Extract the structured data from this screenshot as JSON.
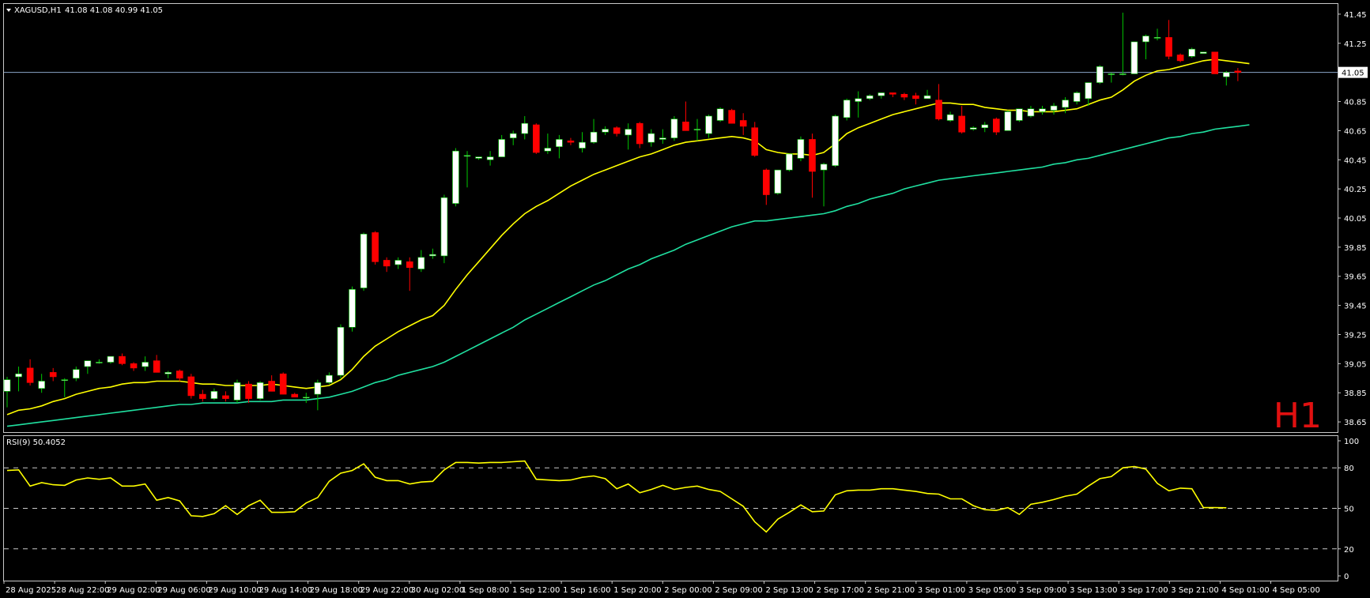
{
  "header": {
    "symbol": "XAGUSD,H1",
    "ohlc": "41.08 41.08 40.99 41.05"
  },
  "timeframe_watermark": "H1",
  "rsi_header": "RSI(9) 50.4052",
  "colors": {
    "background": "#000000",
    "frame": "#c8c8c8",
    "bull_candle": "#ffffff",
    "bear_candle": "#ff0000",
    "wick_bull": "#00c800",
    "wick_bear": "#ff0000",
    "ma_fast": "#ffff00",
    "ma_slow": "#20e0a0",
    "rsi_line": "#ffff00",
    "price_line": "#8aa6c8",
    "watermark": "#e01010"
  },
  "chart_data": [
    {
      "type": "candlestick",
      "instrument": "XAGUSD",
      "timeframe": "H1",
      "ylim": [
        38.58,
        41.52
      ],
      "y_ticks": [
        41.45,
        41.25,
        41.05,
        40.85,
        40.65,
        40.45,
        40.25,
        40.05,
        39.85,
        39.65,
        39.45,
        39.25,
        39.05,
        38.85,
        38.65
      ],
      "last_price": 41.05,
      "x_labels": [
        "28 Aug 2025",
        "28 Aug 22:00",
        "29 Aug 02:00",
        "29 Aug 06:00",
        "29 Aug 10:00",
        "29 Aug 14:00",
        "29 Aug 18:00",
        "29 Aug 22:00",
        "30 Aug 02:00",
        "1 Sep 08:00",
        "1 Sep 12:00",
        "1 Sep 16:00",
        "1 Sep 20:00",
        "2 Sep 00:00",
        "2 Sep 09:00",
        "2 Sep 13:00",
        "2 Sep 17:00",
        "2 Sep 21:00",
        "3 Sep 01:00",
        "3 Sep 05:00",
        "3 Sep 09:00",
        "3 Sep 13:00",
        "3 Sep 17:00",
        "3 Sep 21:00",
        "4 Sep 01:00",
        "4 Sep 05:00"
      ],
      "candles": [
        {
          "o": 38.86,
          "h": 38.96,
          "l": 38.75,
          "c": 38.94
        },
        {
          "o": 38.96,
          "h": 39.03,
          "l": 38.86,
          "c": 38.98
        },
        {
          "o": 39.02,
          "h": 39.08,
          "l": 38.9,
          "c": 38.92
        },
        {
          "o": 38.88,
          "h": 38.98,
          "l": 38.85,
          "c": 38.93
        },
        {
          "o": 38.99,
          "h": 39.02,
          "l": 38.93,
          "c": 38.96
        },
        {
          "o": 38.94,
          "h": 38.95,
          "l": 38.82,
          "c": 38.94
        },
        {
          "o": 38.95,
          "h": 39.03,
          "l": 38.93,
          "c": 39.01
        },
        {
          "o": 39.03,
          "h": 39.07,
          "l": 38.98,
          "c": 39.07
        },
        {
          "o": 39.06,
          "h": 39.08,
          "l": 39.05,
          "c": 39.06
        },
        {
          "o": 39.06,
          "h": 39.1,
          "l": 39.05,
          "c": 39.1
        },
        {
          "o": 39.1,
          "h": 39.12,
          "l": 39.04,
          "c": 39.05
        },
        {
          "o": 39.05,
          "h": 39.06,
          "l": 39.0,
          "c": 39.02
        },
        {
          "o": 39.03,
          "h": 39.1,
          "l": 39.0,
          "c": 39.06
        },
        {
          "o": 39.07,
          "h": 39.11,
          "l": 38.99,
          "c": 38.99
        },
        {
          "o": 38.98,
          "h": 39.0,
          "l": 38.95,
          "c": 38.99
        },
        {
          "o": 39.0,
          "h": 39.01,
          "l": 38.93,
          "c": 38.95
        },
        {
          "o": 38.96,
          "h": 38.98,
          "l": 38.81,
          "c": 38.83
        },
        {
          "o": 38.84,
          "h": 38.87,
          "l": 38.79,
          "c": 38.81
        },
        {
          "o": 38.81,
          "h": 38.88,
          "l": 38.8,
          "c": 38.86
        },
        {
          "o": 38.83,
          "h": 38.86,
          "l": 38.79,
          "c": 38.81
        },
        {
          "o": 38.8,
          "h": 38.94,
          "l": 38.78,
          "c": 38.92
        },
        {
          "o": 38.91,
          "h": 38.93,
          "l": 38.78,
          "c": 38.81
        },
        {
          "o": 38.81,
          "h": 38.93,
          "l": 38.8,
          "c": 38.92
        },
        {
          "o": 38.93,
          "h": 38.97,
          "l": 38.86,
          "c": 38.86
        },
        {
          "o": 38.98,
          "h": 38.99,
          "l": 38.84,
          "c": 38.84
        },
        {
          "o": 38.84,
          "h": 38.85,
          "l": 38.82,
          "c": 38.82
        },
        {
          "o": 38.82,
          "h": 38.85,
          "l": 38.78,
          "c": 38.82
        },
        {
          "o": 38.84,
          "h": 38.94,
          "l": 38.73,
          "c": 38.92
        },
        {
          "o": 38.92,
          "h": 38.99,
          "l": 38.91,
          "c": 38.97
        },
        {
          "o": 38.97,
          "h": 39.32,
          "l": 38.95,
          "c": 39.3
        },
        {
          "o": 39.3,
          "h": 39.58,
          "l": 39.27,
          "c": 39.56
        },
        {
          "o": 39.57,
          "h": 39.95,
          "l": 39.55,
          "c": 39.94
        },
        {
          "o": 39.95,
          "h": 39.96,
          "l": 39.73,
          "c": 39.75
        },
        {
          "o": 39.76,
          "h": 39.78,
          "l": 39.68,
          "c": 39.72
        },
        {
          "o": 39.73,
          "h": 39.78,
          "l": 39.7,
          "c": 39.76
        },
        {
          "o": 39.75,
          "h": 39.78,
          "l": 39.55,
          "c": 39.71
        },
        {
          "o": 39.7,
          "h": 39.83,
          "l": 39.68,
          "c": 39.78
        },
        {
          "o": 39.79,
          "h": 39.84,
          "l": 39.77,
          "c": 39.8
        },
        {
          "o": 39.79,
          "h": 40.21,
          "l": 39.74,
          "c": 40.19
        },
        {
          "o": 40.15,
          "h": 40.53,
          "l": 40.13,
          "c": 40.51
        },
        {
          "o": 40.48,
          "h": 40.51,
          "l": 40.26,
          "c": 40.48
        },
        {
          "o": 40.46,
          "h": 40.47,
          "l": 40.45,
          "c": 40.47
        },
        {
          "o": 40.45,
          "h": 40.51,
          "l": 40.41,
          "c": 40.47
        },
        {
          "o": 40.47,
          "h": 40.62,
          "l": 40.47,
          "c": 40.59
        },
        {
          "o": 40.6,
          "h": 40.65,
          "l": 40.55,
          "c": 40.63
        },
        {
          "o": 40.63,
          "h": 40.75,
          "l": 40.59,
          "c": 40.7
        },
        {
          "o": 40.69,
          "h": 40.7,
          "l": 40.49,
          "c": 40.5
        },
        {
          "o": 40.51,
          "h": 40.63,
          "l": 40.49,
          "c": 40.53
        },
        {
          "o": 40.54,
          "h": 40.62,
          "l": 40.46,
          "c": 40.59
        },
        {
          "o": 40.58,
          "h": 40.6,
          "l": 40.55,
          "c": 40.57
        },
        {
          "o": 40.53,
          "h": 40.64,
          "l": 40.5,
          "c": 40.57
        },
        {
          "o": 40.57,
          "h": 40.73,
          "l": 40.56,
          "c": 40.64
        },
        {
          "o": 40.64,
          "h": 40.68,
          "l": 40.62,
          "c": 40.66
        },
        {
          "o": 40.67,
          "h": 40.68,
          "l": 40.61,
          "c": 40.63
        },
        {
          "o": 40.62,
          "h": 40.7,
          "l": 40.52,
          "c": 40.66
        },
        {
          "o": 40.7,
          "h": 40.71,
          "l": 40.53,
          "c": 40.56
        },
        {
          "o": 40.57,
          "h": 40.66,
          "l": 40.54,
          "c": 40.63
        },
        {
          "o": 40.59,
          "h": 40.66,
          "l": 40.56,
          "c": 40.6
        },
        {
          "o": 40.6,
          "h": 40.75,
          "l": 40.58,
          "c": 40.73
        },
        {
          "o": 40.71,
          "h": 40.85,
          "l": 40.7,
          "c": 40.65
        },
        {
          "o": 40.66,
          "h": 40.73,
          "l": 40.58,
          "c": 40.66
        },
        {
          "o": 40.63,
          "h": 40.76,
          "l": 40.6,
          "c": 40.75
        },
        {
          "o": 40.72,
          "h": 40.81,
          "l": 40.71,
          "c": 40.8
        },
        {
          "o": 40.79,
          "h": 40.8,
          "l": 40.7,
          "c": 40.7
        },
        {
          "o": 40.72,
          "h": 40.77,
          "l": 40.62,
          "c": 40.68
        },
        {
          "o": 40.67,
          "h": 40.71,
          "l": 40.47,
          "c": 40.48
        },
        {
          "o": 40.38,
          "h": 40.39,
          "l": 40.14,
          "c": 40.21
        },
        {
          "o": 40.22,
          "h": 40.26,
          "l": 40.21,
          "c": 40.38
        },
        {
          "o": 40.38,
          "h": 40.49,
          "l": 40.37,
          "c": 40.49
        },
        {
          "o": 40.46,
          "h": 40.61,
          "l": 40.44,
          "c": 40.59
        },
        {
          "o": 40.59,
          "h": 40.63,
          "l": 40.19,
          "c": 40.37
        },
        {
          "o": 40.38,
          "h": 40.43,
          "l": 40.13,
          "c": 40.42
        },
        {
          "o": 40.41,
          "h": 40.76,
          "l": 40.4,
          "c": 40.75
        },
        {
          "o": 40.74,
          "h": 40.87,
          "l": 40.72,
          "c": 40.86
        },
        {
          "o": 40.85,
          "h": 40.92,
          "l": 40.74,
          "c": 40.87
        },
        {
          "o": 40.87,
          "h": 40.9,
          "l": 40.86,
          "c": 40.89
        },
        {
          "o": 40.89,
          "h": 40.91,
          "l": 40.87,
          "c": 40.91
        },
        {
          "o": 40.91,
          "h": 40.91,
          "l": 40.88,
          "c": 40.9
        },
        {
          "o": 40.9,
          "h": 40.91,
          "l": 40.86,
          "c": 40.88
        },
        {
          "o": 40.89,
          "h": 40.91,
          "l": 40.83,
          "c": 40.87
        },
        {
          "o": 40.87,
          "h": 40.93,
          "l": 40.87,
          "c": 40.89
        },
        {
          "o": 40.86,
          "h": 40.97,
          "l": 40.72,
          "c": 40.73
        },
        {
          "o": 40.72,
          "h": 40.78,
          "l": 40.71,
          "c": 40.76
        },
        {
          "o": 40.75,
          "h": 40.82,
          "l": 40.63,
          "c": 40.64
        },
        {
          "o": 40.66,
          "h": 40.68,
          "l": 40.65,
          "c": 40.67
        },
        {
          "o": 40.67,
          "h": 40.71,
          "l": 40.64,
          "c": 40.69
        },
        {
          "o": 40.73,
          "h": 40.74,
          "l": 40.62,
          "c": 40.64
        },
        {
          "o": 40.65,
          "h": 40.79,
          "l": 40.65,
          "c": 40.78
        },
        {
          "o": 40.72,
          "h": 40.79,
          "l": 40.71,
          "c": 40.8
        },
        {
          "o": 40.75,
          "h": 40.82,
          "l": 40.74,
          "c": 40.8
        },
        {
          "o": 40.78,
          "h": 40.82,
          "l": 40.76,
          "c": 40.8
        },
        {
          "o": 40.79,
          "h": 40.84,
          "l": 40.76,
          "c": 40.82
        },
        {
          "o": 40.81,
          "h": 40.88,
          "l": 40.77,
          "c": 40.86
        },
        {
          "o": 40.85,
          "h": 40.92,
          "l": 40.83,
          "c": 40.91
        },
        {
          "o": 40.87,
          "h": 40.98,
          "l": 40.82,
          "c": 40.98
        },
        {
          "o": 40.98,
          "h": 41.1,
          "l": 40.97,
          "c": 41.09
        },
        {
          "o": 41.04,
          "h": 41.05,
          "l": 40.98,
          "c": 41.04
        },
        {
          "o": 41.04,
          "h": 41.46,
          "l": 41.03,
          "c": 41.04
        },
        {
          "o": 41.04,
          "h": 41.25,
          "l": 41.04,
          "c": 41.26
        },
        {
          "o": 41.26,
          "h": 41.31,
          "l": 41.14,
          "c": 41.3
        },
        {
          "o": 41.29,
          "h": 41.35,
          "l": 41.27,
          "c": 41.29
        },
        {
          "o": 41.29,
          "h": 41.41,
          "l": 41.14,
          "c": 41.16
        },
        {
          "o": 41.17,
          "h": 41.18,
          "l": 41.12,
          "c": 41.13
        },
        {
          "o": 41.16,
          "h": 41.22,
          "l": 41.15,
          "c": 41.21
        },
        {
          "o": 41.18,
          "h": 41.19,
          "l": 41.19,
          "c": 41.19
        },
        {
          "o": 41.19,
          "h": 41.19,
          "l": 41.04,
          "c": 41.04
        },
        {
          "o": 41.02,
          "h": 41.06,
          "l": 40.96,
          "c": 41.05
        },
        {
          "o": 41.06,
          "h": 41.08,
          "l": 40.99,
          "c": 41.05
        }
      ],
      "ma_fast": [
        38.7,
        38.73,
        38.74,
        38.76,
        38.79,
        38.81,
        38.84,
        38.86,
        38.88,
        38.89,
        38.91,
        38.92,
        38.92,
        38.93,
        38.93,
        38.93,
        38.92,
        38.91,
        38.91,
        38.9,
        38.9,
        38.9,
        38.9,
        38.91,
        38.9,
        38.89,
        38.88,
        38.89,
        38.9,
        38.94,
        39.01,
        39.1,
        39.17,
        39.22,
        39.27,
        39.31,
        39.35,
        39.38,
        39.45,
        39.56,
        39.66,
        39.75,
        39.84,
        39.93,
        40.01,
        40.08,
        40.13,
        40.17,
        40.22,
        40.27,
        40.31,
        40.35,
        40.38,
        40.41,
        40.44,
        40.47,
        40.49,
        40.52,
        40.55,
        40.57,
        40.58,
        40.59,
        40.6,
        40.61,
        40.6,
        40.58,
        40.52,
        40.5,
        40.49,
        40.49,
        40.48,
        40.5,
        40.56,
        40.63,
        40.67,
        40.7,
        40.73,
        40.76,
        40.78,
        40.8,
        40.82,
        40.84,
        40.84,
        40.83,
        40.83,
        40.81,
        40.8,
        40.79,
        40.79,
        40.78,
        40.78,
        40.78,
        40.79,
        40.8,
        40.83,
        40.86,
        40.88,
        40.93,
        40.99,
        41.03,
        41.06,
        41.07,
        41.09,
        41.11,
        41.13,
        41.14,
        41.13,
        41.12,
        41.11
      ],
      "ma_slow": [
        38.62,
        38.63,
        38.64,
        38.65,
        38.66,
        38.67,
        38.68,
        38.69,
        38.7,
        38.71,
        38.72,
        38.73,
        38.74,
        38.75,
        38.76,
        38.77,
        38.77,
        38.78,
        38.78,
        38.78,
        38.78,
        38.79,
        38.79,
        38.79,
        38.8,
        38.8,
        38.8,
        38.81,
        38.82,
        38.84,
        38.86,
        38.89,
        38.92,
        38.94,
        38.97,
        38.99,
        39.01,
        39.03,
        39.06,
        39.1,
        39.14,
        39.18,
        39.22,
        39.26,
        39.3,
        39.35,
        39.39,
        39.43,
        39.47,
        39.51,
        39.55,
        39.59,
        39.62,
        39.66,
        39.7,
        39.73,
        39.77,
        39.8,
        39.83,
        39.87,
        39.9,
        39.93,
        39.96,
        39.99,
        40.01,
        40.03,
        40.03,
        40.04,
        40.05,
        40.06,
        40.07,
        40.08,
        40.1,
        40.13,
        40.15,
        40.18,
        40.2,
        40.22,
        40.25,
        40.27,
        40.29,
        40.31,
        40.32,
        40.33,
        40.34,
        40.35,
        40.36,
        40.37,
        40.38,
        40.39,
        40.4,
        40.42,
        40.43,
        40.45,
        40.46,
        40.48,
        40.5,
        40.52,
        40.54,
        40.56,
        40.58,
        40.6,
        40.61,
        40.63,
        40.64,
        40.66,
        40.67,
        40.68,
        40.69
      ]
    },
    {
      "type": "line",
      "indicator": "RSI(9)",
      "last_value": 50.4052,
      "ylim": [
        0,
        100
      ],
      "y_ticks": [
        100,
        80,
        50,
        20,
        0
      ],
      "levels": [
        80,
        50,
        20
      ],
      "values": [
        78.0,
        78.5,
        66.5,
        69.0,
        67.5,
        67.0,
        71.0,
        72.5,
        71.5,
        72.5,
        66.5,
        66.5,
        68.0,
        56.0,
        58.0,
        55.5,
        44.5,
        44.0,
        46.0,
        52.0,
        45.5,
        52.0,
        56.0,
        47.0,
        47.0,
        47.5,
        54.0,
        58.0,
        70.0,
        76.0,
        78.0,
        83.0,
        73.0,
        70.5,
        70.5,
        68.0,
        69.5,
        70.0,
        78.5,
        84.0,
        84.0,
        83.5,
        84.0,
        84.0,
        84.5,
        85.0,
        71.5,
        71.0,
        70.5,
        71.0,
        73.0,
        74.0,
        72.0,
        64.5,
        68.0,
        61.5,
        64.0,
        67.0,
        64.0,
        65.5,
        66.5,
        64.0,
        62.5,
        57.0,
        51.5,
        40.0,
        32.5,
        42.0,
        47.0,
        52.5,
        47.5,
        48.0,
        60.0,
        63.0,
        63.5,
        63.5,
        64.5,
        64.5,
        63.5,
        62.5,
        61.0,
        60.5,
        57.0,
        57.0,
        52.0,
        49.0,
        48.5,
        50.5,
        45.5,
        53.0,
        54.5,
        56.5,
        59.0,
        60.5,
        66.5,
        72.0,
        73.5,
        80.0,
        81.0,
        79.0,
        68.5,
        63.0,
        65.0,
        64.5,
        50.5,
        50.5,
        50.4
      ]
    }
  ]
}
